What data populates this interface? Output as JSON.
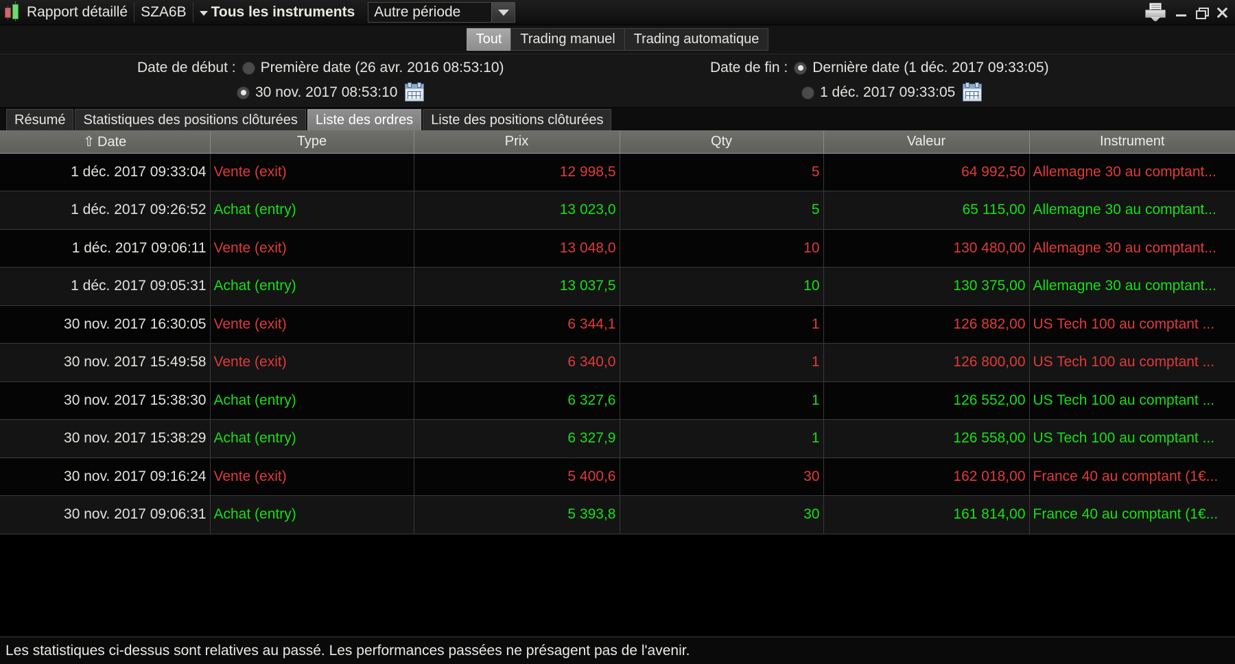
{
  "titlebar": {
    "app_icon": "candlestick-icon",
    "report_title": "Rapport détaillé",
    "account": "SZA6B",
    "instrument_filter": "Tous les instruments",
    "period_select": "Autre période",
    "print_icon": "printer-icon",
    "minimize_icon": "minimize-icon",
    "restore_icon": "restore-icon",
    "close_icon": "close-icon"
  },
  "mode_tabs": [
    {
      "label": "Tout",
      "active": true
    },
    {
      "label": "Trading manuel",
      "active": false
    },
    {
      "label": "Trading automatique",
      "active": false
    }
  ],
  "dates": {
    "start_label": "Date de début :",
    "start_first_option": "Première date (26 avr. 2016 08:53:10)",
    "start_first_selected": false,
    "start_custom_value": "30 nov. 2017 08:53:10",
    "start_custom_selected": true,
    "end_label": "Date de fin :",
    "end_last_option": "Dernière date (1 déc. 2017 09:33:05)",
    "end_last_selected": true,
    "end_custom_value": "1 déc. 2017 09:33:05",
    "end_custom_selected": false,
    "calendar_icon": "calendar-icon"
  },
  "sub_tabs": [
    {
      "label": "Résumé",
      "active": false
    },
    {
      "label": "Statistiques des positions clôturées",
      "active": false
    },
    {
      "label": "Liste des ordres",
      "active": true
    },
    {
      "label": "Liste des positions clôturées",
      "active": false
    }
  ],
  "table": {
    "sort_indicator": "⇧",
    "columns": [
      "Date",
      "Type",
      "Prix",
      "Qty",
      "Valeur",
      "Instrument"
    ],
    "rows": [
      {
        "date": "1 déc. 2017 09:33:04",
        "type": "Vente (exit)",
        "prix": "12 998,5",
        "qty": "5",
        "valeur": "64 992,50",
        "instrument": "Allemagne 30 au comptant...",
        "side": "sell"
      },
      {
        "date": "1 déc. 2017 09:26:52",
        "type": "Achat (entry)",
        "prix": "13 023,0",
        "qty": "5",
        "valeur": "65 115,00",
        "instrument": "Allemagne 30 au comptant...",
        "side": "buy"
      },
      {
        "date": "1 déc. 2017 09:06:11",
        "type": "Vente (exit)",
        "prix": "13 048,0",
        "qty": "10",
        "valeur": "130 480,00",
        "instrument": "Allemagne 30 au comptant...",
        "side": "sell"
      },
      {
        "date": "1 déc. 2017 09:05:31",
        "type": "Achat (entry)",
        "prix": "13 037,5",
        "qty": "10",
        "valeur": "130 375,00",
        "instrument": "Allemagne 30 au comptant...",
        "side": "buy"
      },
      {
        "date": "30 nov. 2017 16:30:05",
        "type": "Vente (exit)",
        "prix": "6 344,1",
        "qty": "1",
        "valeur": "126 882,00",
        "instrument": "US Tech 100 au comptant ...",
        "side": "sell"
      },
      {
        "date": "30 nov. 2017 15:49:58",
        "type": "Vente (exit)",
        "prix": "6 340,0",
        "qty": "1",
        "valeur": "126 800,00",
        "instrument": "US Tech 100 au comptant ...",
        "side": "sell"
      },
      {
        "date": "30 nov. 2017 15:38:30",
        "type": "Achat (entry)",
        "prix": "6 327,6",
        "qty": "1",
        "valeur": "126 552,00",
        "instrument": "US Tech 100 au comptant ...",
        "side": "buy"
      },
      {
        "date": "30 nov. 2017 15:38:29",
        "type": "Achat (entry)",
        "prix": "6 327,9",
        "qty": "1",
        "valeur": "126 558,00",
        "instrument": "US Tech 100 au comptant ...",
        "side": "buy"
      },
      {
        "date": "30 nov. 2017 09:16:24",
        "type": "Vente (exit)",
        "prix": "5 400,6",
        "qty": "30",
        "valeur": "162 018,00",
        "instrument": "France 40 au comptant (1€...",
        "side": "sell"
      },
      {
        "date": "30 nov. 2017 09:06:31",
        "type": "Achat (entry)",
        "prix": "5 393,8",
        "qty": "30",
        "valeur": "161 814,00",
        "instrument": "France 40 au comptant (1€...",
        "side": "buy"
      }
    ]
  },
  "footer": {
    "disclaimer": "Les statistiques ci-dessus sont relatives au passé. Les performances passées ne présagent pas de l'avenir."
  },
  "colors": {
    "buy": "#15e015",
    "sell": "#e03a3a",
    "text": "#e6e6e2"
  }
}
